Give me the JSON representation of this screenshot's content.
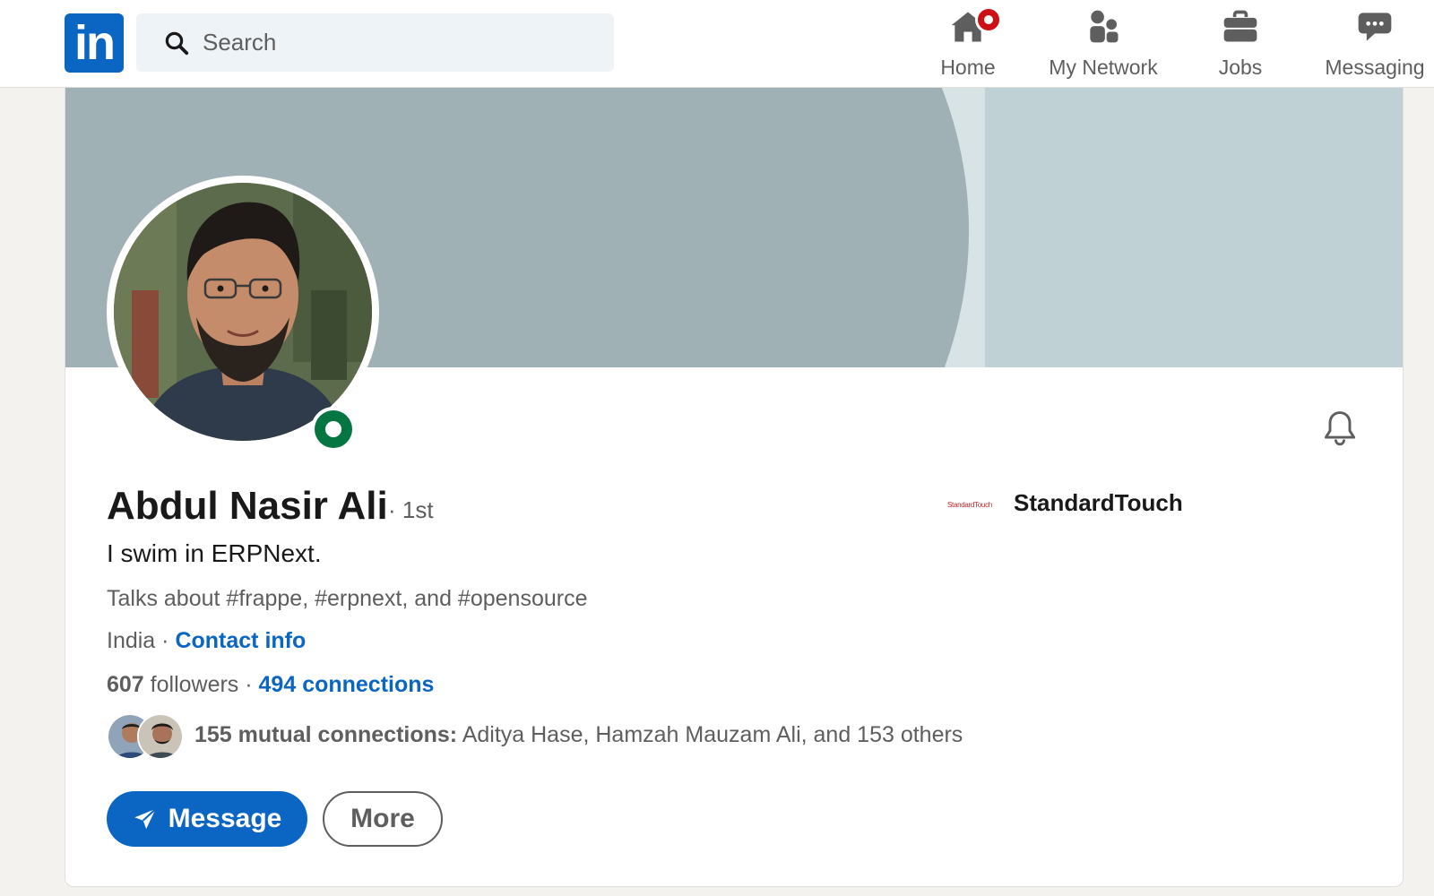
{
  "nav": {
    "logo_text": "in",
    "search_placeholder": "Search",
    "items": [
      {
        "label": "Home",
        "icon": "home-icon",
        "has_notification": true
      },
      {
        "label": "My Network",
        "icon": "network-icon"
      },
      {
        "label": "Jobs",
        "icon": "briefcase-icon"
      },
      {
        "label": "Messaging",
        "icon": "messaging-icon"
      }
    ]
  },
  "profile": {
    "name": "Abdul Nasir Ali",
    "degree": "· 1st",
    "headline": "I swim in ERPNext.",
    "talks_about": "Talks about #frappe, #erpnext, and #opensource",
    "location": "India",
    "location_separator": " · ",
    "contact_info_label": "Contact info",
    "followers_count": "607",
    "followers_label": " followers",
    "stats_separator": "  · ",
    "connections_label": "494 connections",
    "mutual_bold": "155 mutual connections:",
    "mutual_rest": " Aditya Hase, Hamzah Mauzam Ali, and 153 others",
    "online_status": "online"
  },
  "company": {
    "logo_text": "StandardTouch",
    "name": "StandardTouch"
  },
  "actions": {
    "message_label": "Message",
    "more_label": "More"
  },
  "colors": {
    "brand": "#0a66c2",
    "online": "#057642",
    "notification": "#cc1016"
  }
}
